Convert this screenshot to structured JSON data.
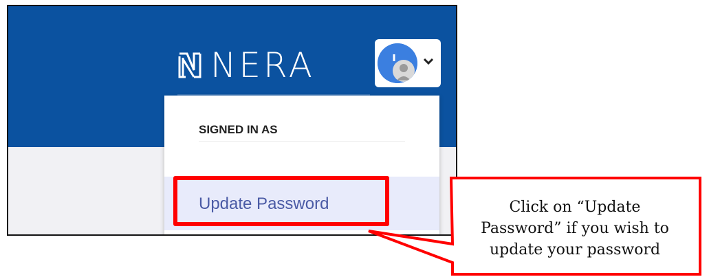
{
  "brand": {
    "name": "NERA",
    "primary_color": "#0b52a0"
  },
  "user_menu": {
    "avatar_icon": "user-avatar-icon",
    "chevron_icon": "chevron-down-icon",
    "signed_in_label": "SIGNED IN AS",
    "signed_in_user": "",
    "items": [
      {
        "label": "Update Password",
        "highlighted": true
      }
    ]
  },
  "annotation": {
    "lines": [
      "Click on “Update",
      "Password” if you wish to",
      "update your password"
    ],
    "border_color": "#ff0000"
  }
}
